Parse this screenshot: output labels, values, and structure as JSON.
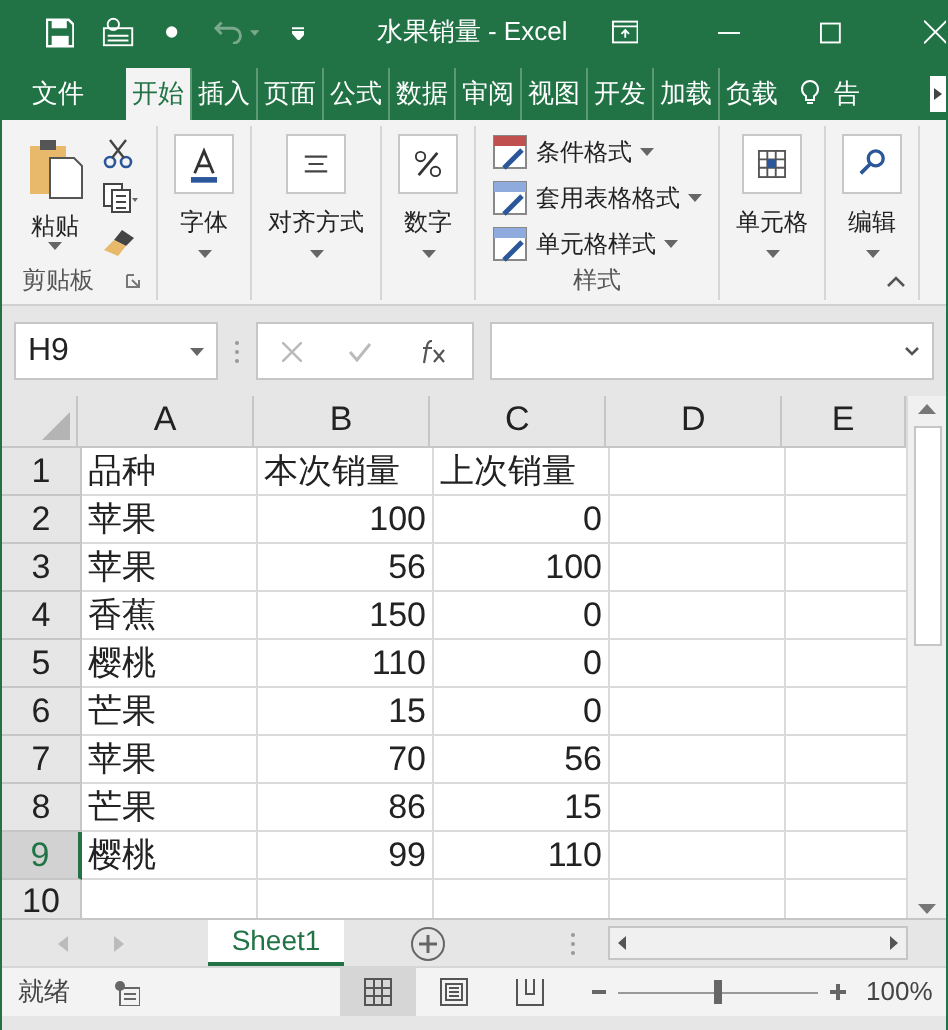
{
  "title_bar": {
    "title": "水果销量 - Excel"
  },
  "ribbon_tabs": [
    {
      "label": "文件",
      "selected": false
    },
    {
      "label": "开始",
      "selected": true
    },
    {
      "label": "插入",
      "selected": false
    },
    {
      "label": "页面",
      "selected": false
    },
    {
      "label": "公式",
      "selected": false
    },
    {
      "label": "数据",
      "selected": false
    },
    {
      "label": "审阅",
      "selected": false
    },
    {
      "label": "视图",
      "selected": false
    },
    {
      "label": "开发",
      "selected": false
    },
    {
      "label": "加载",
      "selected": false
    },
    {
      "label": "负载",
      "selected": false
    },
    {
      "label": "告",
      "selected": false
    }
  ],
  "ribbon_groups": [
    {
      "kind": "clipboard",
      "buttons": [
        "粘贴"
      ],
      "label": "剪贴板"
    },
    {
      "kind": "font",
      "buttons": [
        "字体"
      ]
    },
    {
      "kind": "align",
      "buttons": [
        "对齐方式"
      ]
    },
    {
      "kind": "number",
      "buttons": [
        "数字"
      ]
    },
    {
      "kind": "styles",
      "buttons": [
        "条件格式",
        "套用表格格式",
        "单元格样式"
      ],
      "label": "样式"
    },
    {
      "kind": "cells",
      "buttons": [
        "单元格"
      ]
    },
    {
      "kind": "editing",
      "buttons": [
        "编辑"
      ]
    }
  ],
  "formula_bar": {
    "name_box": "H9"
  },
  "sheet": {
    "columns": [
      "A",
      "B",
      "C",
      "D",
      "E"
    ],
    "rows": [
      {
        "number": "1",
        "kind": "header",
        "selected": false,
        "cells": [
          "品种",
          "本次销量",
          "上次销量"
        ]
      },
      {
        "number": "2",
        "kind": "data",
        "selected": false,
        "cells": [
          "苹果",
          "100",
          "0"
        ]
      },
      {
        "number": "3",
        "kind": "data",
        "selected": false,
        "cells": [
          "苹果",
          "56",
          "100"
        ]
      },
      {
        "number": "4",
        "kind": "data",
        "selected": false,
        "cells": [
          "香蕉",
          "150",
          "0"
        ]
      },
      {
        "number": "5",
        "kind": "data",
        "selected": false,
        "cells": [
          "樱桃",
          "110",
          "0"
        ]
      },
      {
        "number": "6",
        "kind": "data",
        "selected": false,
        "cells": [
          "芒果",
          "15",
          "0"
        ]
      },
      {
        "number": "7",
        "kind": "data",
        "selected": false,
        "cells": [
          "苹果",
          "70",
          "56"
        ]
      },
      {
        "number": "8",
        "kind": "data",
        "selected": false,
        "cells": [
          "芒果",
          "86",
          "15"
        ]
      },
      {
        "number": "9",
        "kind": "data",
        "selected": true,
        "cells": [
          "樱桃",
          "99",
          "110"
        ]
      },
      {
        "number": "10",
        "kind": "data",
        "selected": false
      }
    ]
  },
  "sheet_tabs": [
    {
      "label": "Sheet1",
      "selected": true
    }
  ],
  "status_bar": {
    "status": "就绪",
    "views": [
      {
        "kind": "normal",
        "selected": true
      },
      {
        "kind": "page_layout",
        "selected": false
      },
      {
        "kind": "page_break",
        "selected": false
      }
    ],
    "zoom_level": {
      "level": 0.5
    },
    "zoom": "100%"
  }
}
